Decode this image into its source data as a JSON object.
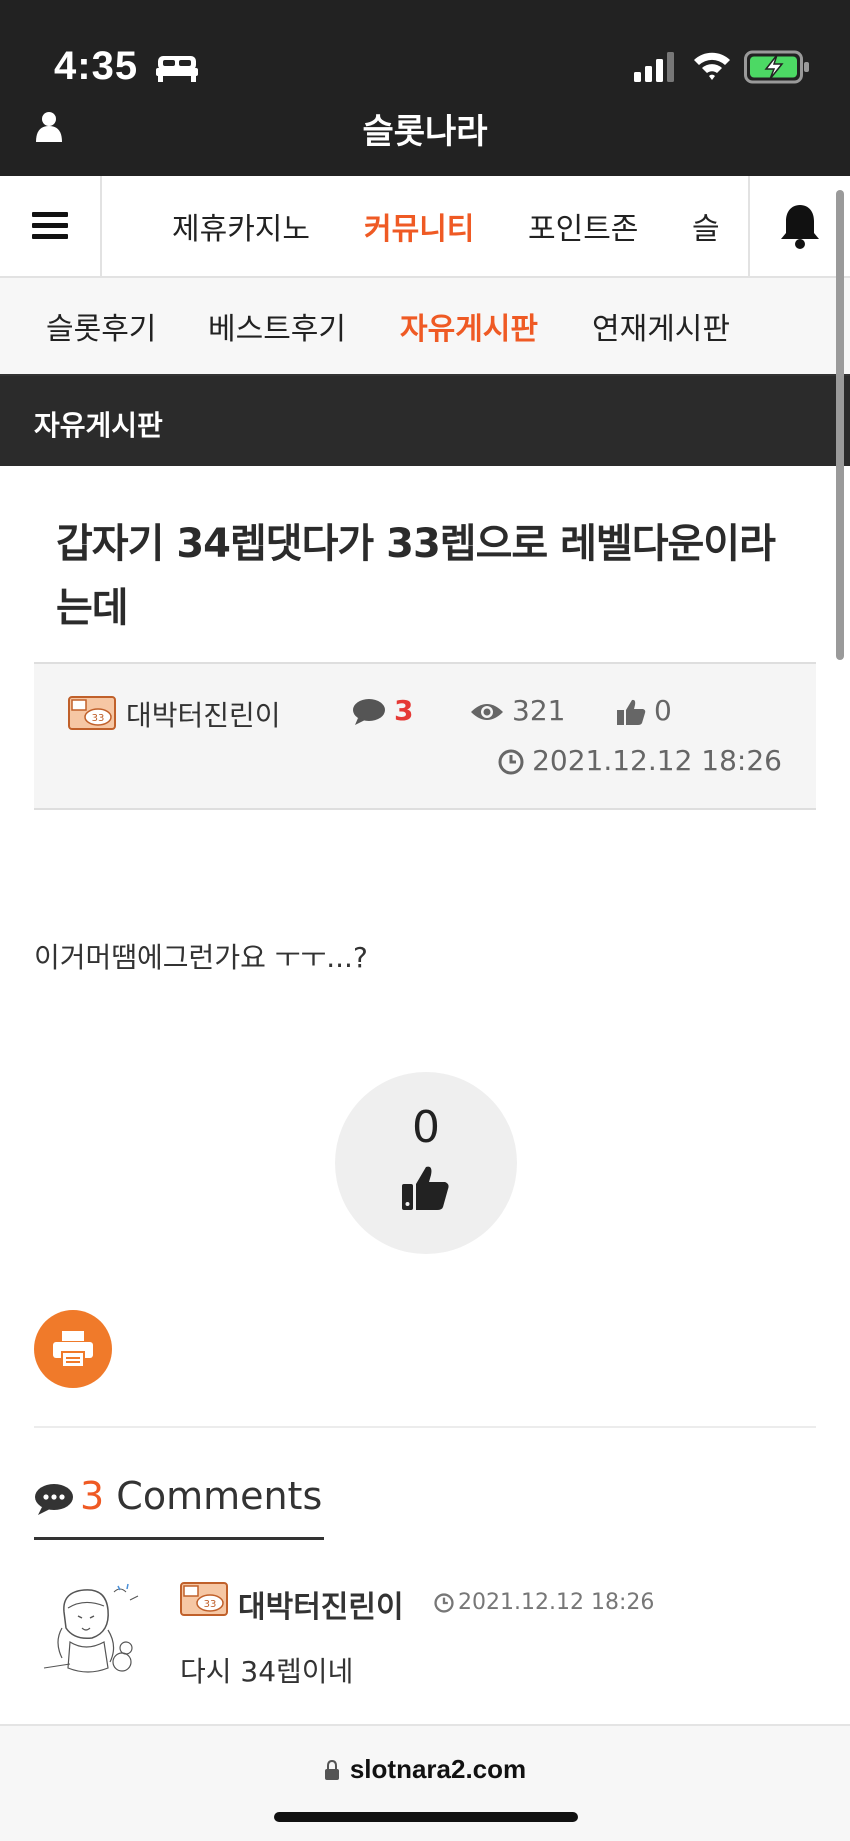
{
  "status_bar": {
    "time": "4:35",
    "icons": [
      "bed-icon",
      "signal-icon",
      "wifi-icon",
      "battery-charging-icon"
    ]
  },
  "header": {
    "site_title": "슬롯나라",
    "user_icon": "user-icon"
  },
  "main_nav": {
    "menu_icon": "hamburger-icon",
    "items": [
      {
        "label": "제휴카지노",
        "active": false
      },
      {
        "label": "커뮤니티",
        "active": true
      },
      {
        "label": "포인트존",
        "active": false
      },
      {
        "label": "슬",
        "active": false
      }
    ],
    "bell_icon": "bell-icon"
  },
  "sub_nav": {
    "items": [
      {
        "label": "슬롯후기",
        "active": false
      },
      {
        "label": "베스트후기",
        "active": false
      },
      {
        "label": "자유게시판",
        "active": true
      },
      {
        "label": "연재게시판",
        "active": false
      }
    ]
  },
  "board": {
    "title": "자유게시판"
  },
  "post": {
    "title": "갑자기 34렙댓다가 33렙으로 레벨다운이라는데",
    "author": "대박터진린이",
    "comment_count": "3",
    "views": "321",
    "likes": "0",
    "date": "2021.12.12 18:26",
    "body": "이거머땜에그런가요 ㅜㅜ...?",
    "like_button_count": "0"
  },
  "comments_section": {
    "count": "3",
    "label": "Comments",
    "items": [
      {
        "author": "대박터진린이",
        "date": "2021.12.12 18:26",
        "text": "다시 34렙이네"
      }
    ]
  },
  "browser": {
    "url": "slotnara2.com"
  },
  "colors": {
    "accent": "#ef5a24",
    "header_bg": "#222222",
    "comment_count": "#e53935",
    "print_button": "#f07a2a"
  }
}
